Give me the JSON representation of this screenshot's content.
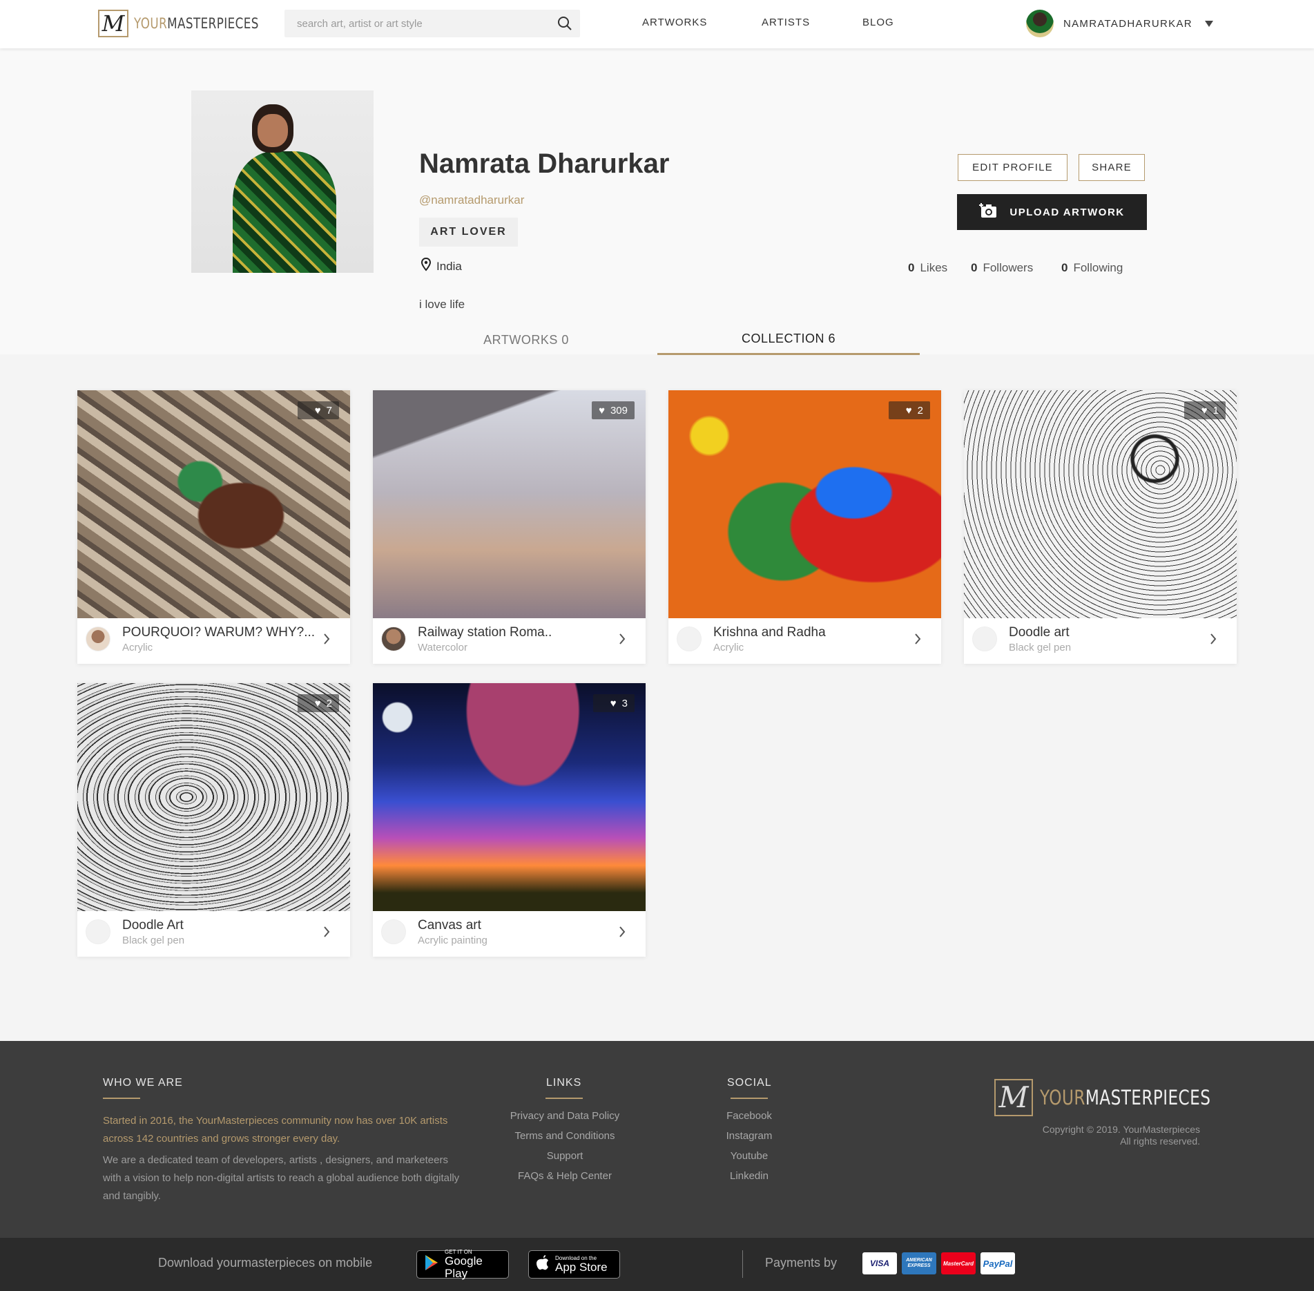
{
  "header": {
    "logo_brand_a": "YOUR",
    "logo_brand_b": "MASTERPIECES",
    "logo_mark": "M",
    "search_placeholder": "search art, artist or art style",
    "nav": [
      "ARTWORKS",
      "ARTISTS",
      "BLOG"
    ],
    "username": "NAMRATADHARURKAR"
  },
  "profile": {
    "name": "Namrata Dharurkar",
    "handle": "@namratadharurkar",
    "badge": "ART LOVER",
    "location": "India",
    "bio": "i love life",
    "edit_label": "EDIT PROFILE",
    "share_label": "SHARE",
    "upload_label": "UPLOAD ARTWORK",
    "stats": {
      "likes_count": "0",
      "likes_label": "Likes",
      "followers_count": "0",
      "followers_label": "Followers",
      "following_count": "0",
      "following_label": "Following"
    }
  },
  "tabs": {
    "artworks": "ARTWORKS 0",
    "collection": "COLLECTION 6"
  },
  "collection": [
    {
      "title": "POURQUOI? WARUM? WHY?...",
      "medium": "Acrylic",
      "likes": "7"
    },
    {
      "title": "Railway station Roma..",
      "medium": "Watercolor",
      "likes": "309"
    },
    {
      "title": "Krishna and Radha",
      "medium": "Acrylic",
      "likes": "2"
    },
    {
      "title": "Doodle art",
      "medium": "Black gel pen",
      "likes": "1"
    },
    {
      "title": "Doodle Art",
      "medium": "Black gel pen",
      "likes": "2"
    },
    {
      "title": "Canvas art",
      "medium": "Acrylic painting",
      "likes": "3"
    }
  ],
  "footer": {
    "who_heading": "WHO WE ARE",
    "who_gold": "Started in 2016, the YourMasterpieces community now has over 10K artists across 142 countries and grows stronger every day.",
    "who_text": "We are a dedicated team of developers, artists , designers, and marketeers with a vision to help non-digital artists to reach a global audience both digitally and tangibly.",
    "links_heading": "LINKS",
    "links": [
      "Privacy and Data Policy",
      "Terms and Conditions",
      "Support",
      "FAQs & Help Center"
    ],
    "social_heading": "SOCIAL",
    "social": [
      "Facebook",
      "Instagram",
      "Youtube",
      "Linkedin"
    ],
    "copyright_1": "Copyright © 2019. YourMasterpieces",
    "copyright_2": "All rights reserved."
  },
  "bottom": {
    "download_text": "Download yourmasterpieces on mobile",
    "google_small": "GET IT ON",
    "google_big": "Google Play",
    "apple_small": "Download on the",
    "apple_big": "App Store",
    "payments_text": "Payments by",
    "payment_methods": [
      "VISA",
      "AMERICAN EXPRESS",
      "MasterCard",
      "PayPal"
    ]
  },
  "colors": {
    "accent": "#b59a6d",
    "dark": "#222222",
    "footer": "#3d3d3d"
  }
}
